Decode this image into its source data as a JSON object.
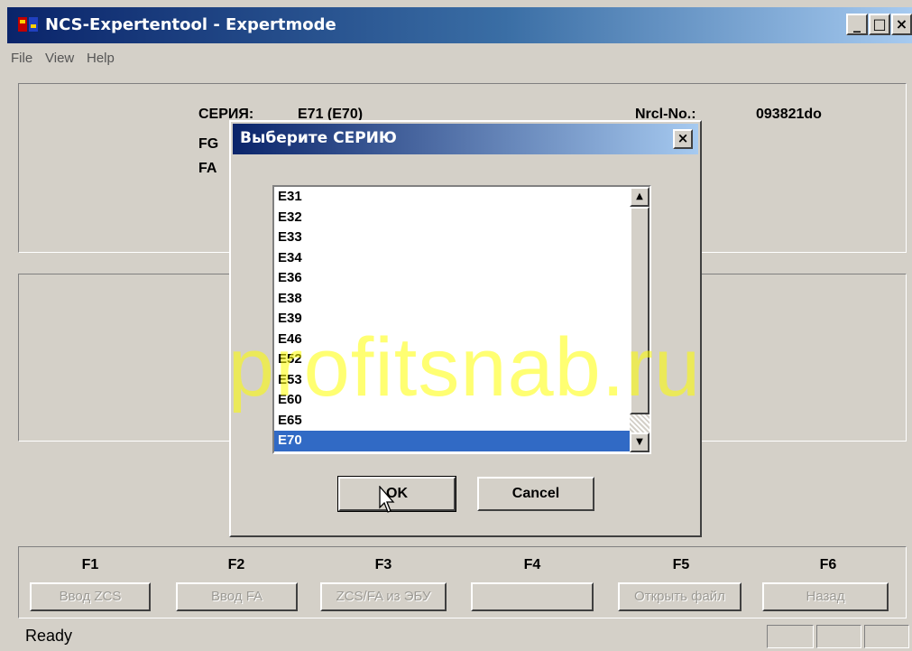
{
  "window": {
    "title": "NCS-Expertentool - Expertmode",
    "controls": {
      "minimize": "_",
      "maximize": "□",
      "close": "×"
    }
  },
  "menu": [
    "File",
    "View",
    "Help"
  ],
  "info": {
    "series_label": "СЕРИЯ:",
    "series_value": "E71 (E70)",
    "nrcl_label": "Nrcl-No.:",
    "nrcl_value": "093821do",
    "fg_label": "FG",
    "fa_label": "FA"
  },
  "function_keys": [
    {
      "key": "F1",
      "button": "Ввод ZCS"
    },
    {
      "key": "F2",
      "button": "Ввод FA"
    },
    {
      "key": "F3",
      "button": "ZCS/FA из ЭБУ"
    },
    {
      "key": "F4",
      "button": ""
    },
    {
      "key": "F5",
      "button": "Открыть файл"
    },
    {
      "key": "F6",
      "button": "Назад"
    }
  ],
  "status": {
    "text": "Ready"
  },
  "dialog": {
    "title": "Выберите СЕРИЮ",
    "close": "×",
    "list": [
      "E31",
      "E32",
      "E33",
      "E34",
      "E36",
      "E38",
      "E39",
      "E46",
      "E52",
      "E53",
      "E60",
      "E65",
      "E70"
    ],
    "selected": "E70",
    "ok_label": "OK",
    "cancel_label": "Cancel"
  },
  "watermark": "profitsnab.ru",
  "colors": {
    "titlebar_start": "#0a246a",
    "selection": "#316ac5",
    "face": "#d4d0c8",
    "watermark": "#ffff00"
  },
  "icons": {
    "app": "ncs-app-icon",
    "cursor": "mouse-pointer-icon",
    "scroll_up": "arrow-up-icon",
    "scroll_down": "arrow-down-icon"
  }
}
